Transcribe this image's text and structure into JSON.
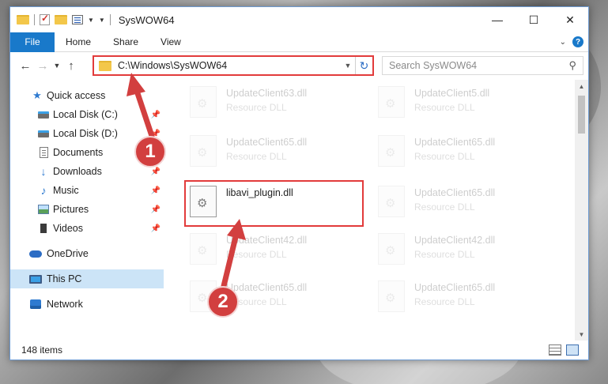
{
  "window": {
    "title": "SysWOW64",
    "controls": {
      "minimize": "—",
      "maximize": "☐",
      "close": "✕"
    }
  },
  "ribbon": {
    "file_tab": "File",
    "tabs": [
      "Home",
      "Share",
      "View"
    ]
  },
  "nav": {
    "address": "C:\\Windows\\SysWOW64",
    "search_placeholder": "Search SysWOW64"
  },
  "sidebar": {
    "items": [
      {
        "label": "Quick access",
        "icon": "star-icon"
      },
      {
        "label": "Local Disk (C:)",
        "icon": "drive-icon",
        "pinned": true
      },
      {
        "label": "Local Disk (D:)",
        "icon": "drive-icon",
        "pinned": true
      },
      {
        "label": "Documents",
        "icon": "documents-icon",
        "pinned": true
      },
      {
        "label": "Downloads",
        "icon": "downloads-icon",
        "pinned": true
      },
      {
        "label": "Music",
        "icon": "music-icon",
        "pinned": true
      },
      {
        "label": "Pictures",
        "icon": "pictures-icon",
        "pinned": true
      },
      {
        "label": "Videos",
        "icon": "videos-icon",
        "pinned": true
      },
      {
        "label": "OneDrive",
        "icon": "onedrive-icon"
      },
      {
        "label": "This PC",
        "icon": "this-pc-icon",
        "selected": true
      },
      {
        "label": "Network",
        "icon": "network-icon"
      }
    ]
  },
  "files": {
    "left_column": [
      {
        "name": "UpdateClient63.dll",
        "type": "Resource DLL"
      },
      {
        "name": "UpdateClient65.dll",
        "type": "Resource DLL"
      },
      {
        "name": "libavi_plugin.dll",
        "type": ""
      },
      {
        "name": "UpdateClient42.dll",
        "type": "Resource DLL"
      },
      {
        "name": "UpdateClient65.dll",
        "type": "Resource DLL"
      }
    ],
    "right_column": [
      {
        "name": "UpdateClient5.dll",
        "type": "Resource DLL"
      },
      {
        "name": "UpdateClient65.dll",
        "type": "Resource DLL"
      },
      {
        "name": "UpdateClient65.dll",
        "type": "Resource DLL"
      },
      {
        "name": "UpdateClient42.dll",
        "type": "Resource DLL"
      },
      {
        "name": "UpdateClient65.dll",
        "type": "Resource DLL"
      }
    ]
  },
  "status": {
    "item_count": "148 items"
  },
  "annotations": {
    "badge_1": "1",
    "badge_2": "2",
    "color": "#d23f3f"
  }
}
